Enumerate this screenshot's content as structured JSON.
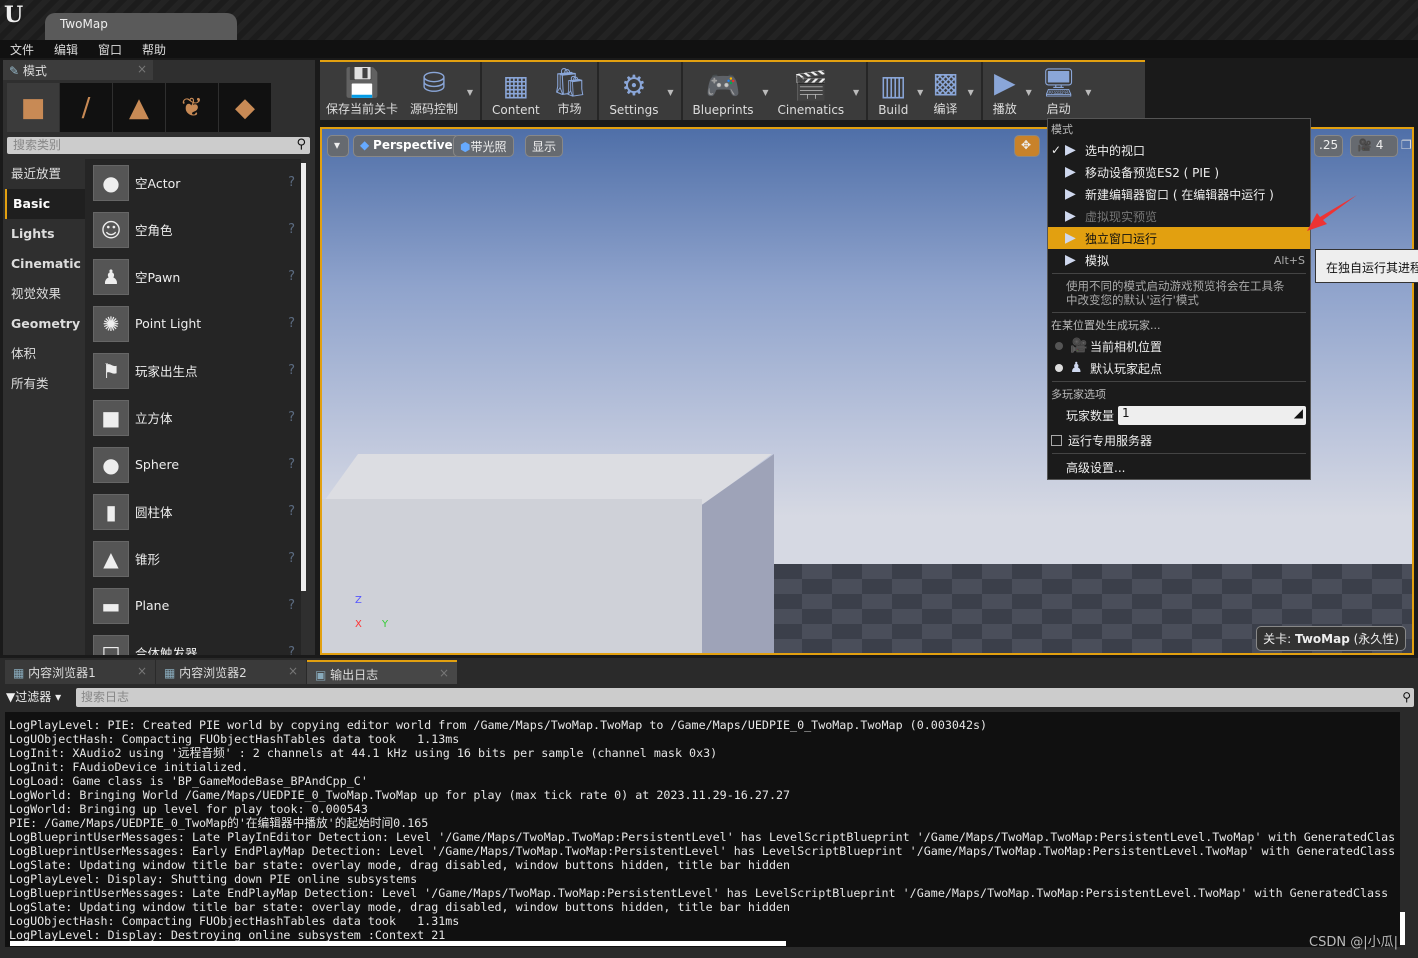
{
  "window": {
    "doc_tab": "TwoMap"
  },
  "menubar": [
    "文件",
    "编辑",
    "窗口",
    "帮助"
  ],
  "modes_panel": {
    "tab": "模式",
    "search_placeholder": "搜索类别",
    "categories": [
      "最近放置",
      "Basic",
      "Lights",
      "Cinematic",
      "视觉效果",
      "Geometry",
      "体积",
      "所有类"
    ],
    "selected_category": "Basic",
    "items": [
      "空Actor",
      "空角色",
      "空Pawn",
      "Point Light",
      "玩家出生点",
      "立方体",
      "Sphere",
      "圆柱体",
      "锥形",
      "Plane",
      "合体触发器"
    ]
  },
  "toolbar": [
    {
      "label": "保存当前关卡",
      "icon": "save-icon",
      "dropdown": false
    },
    {
      "label": "源码控制",
      "icon": "source-control-icon",
      "dropdown": true
    },
    {
      "label": "Content",
      "icon": "content-icon",
      "dropdown": false
    },
    {
      "label": "市场",
      "icon": "marketplace-icon",
      "dropdown": false
    },
    {
      "label": "Settings",
      "icon": "settings-icon",
      "dropdown": true
    },
    {
      "label": "Blueprints",
      "icon": "blueprints-icon",
      "dropdown": true
    },
    {
      "label": "Cinematics",
      "icon": "cinematics-icon",
      "dropdown": true
    },
    {
      "label": "Build",
      "icon": "build-icon",
      "dropdown": true
    },
    {
      "label": "编译",
      "icon": "compile-icon",
      "dropdown": true
    },
    {
      "label": "播放",
      "icon": "play-icon",
      "dropdown": true
    },
    {
      "label": "启动",
      "icon": "launch-icon",
      "dropdown": true
    }
  ],
  "viewport": {
    "perspective": "Perspective",
    "lighting": "带光照",
    "show": "显示",
    "snap_value": ".25",
    "camera_speed": "4",
    "level_label_prefix": "关卡:",
    "level_name": "TwoMap",
    "level_suffix": "(永久性)",
    "axis_z": "Z",
    "axis_x": "X",
    "axis_y": "Y"
  },
  "play_menu": {
    "mode_header": "模式",
    "modes": [
      {
        "label": "选中的视口",
        "checked": true,
        "disabled": false,
        "highlighted": false,
        "shortcut": ""
      },
      {
        "label": "移动设备预览ES2 ( PIE )",
        "checked": false,
        "disabled": false,
        "highlighted": false,
        "shortcut": ""
      },
      {
        "label": "新建编辑器窗口 ( 在编辑器中运行 )",
        "checked": false,
        "disabled": false,
        "highlighted": false,
        "shortcut": ""
      },
      {
        "label": "虚拟现实预览",
        "checked": false,
        "disabled": true,
        "highlighted": false,
        "shortcut": ""
      },
      {
        "label": "独立窗口运行",
        "checked": false,
        "disabled": false,
        "highlighted": true,
        "shortcut": ""
      },
      {
        "label": "模拟",
        "checked": false,
        "disabled": false,
        "highlighted": false,
        "shortcut": "Alt+S"
      }
    ],
    "description": "使用不同的模式启动游戏预览将会在工具条中改变您的默认'运行'模式",
    "spawn_header": "在某位置处生成玩家...",
    "spawn_options": [
      {
        "label": "当前相机位置",
        "selected": false
      },
      {
        "label": "默认玩家起点",
        "selected": true
      }
    ],
    "multiplayer_header": "多玩家选项",
    "players_label": "玩家数量",
    "players_value": "1",
    "dedicated_server": "运行专用服务器",
    "dedicated_server_checked": false,
    "advanced": "高级设置..."
  },
  "tooltip": "在独自运行其进程",
  "bottom_tabs": [
    {
      "label": "内容浏览器1",
      "active": false
    },
    {
      "label": "内容浏览器2",
      "active": false
    },
    {
      "label": "输出日志",
      "active": true
    }
  ],
  "log": {
    "filter": "过滤器",
    "search_placeholder": "搜索日志",
    "lines": [
      "LogPlayLevel: PIE: Created PIE world by copying editor world from /Game/Maps/TwoMap.TwoMap to /Game/Maps/UEDPIE_0_TwoMap.TwoMap (0.003042s)",
      "LogUObjectHash: Compacting FUObjectHashTables data took   1.13ms",
      "LogInit: XAudio2 using '远程音频' : 2 channels at 44.1 kHz using 16 bits per sample (channel mask 0x3)",
      "LogInit: FAudioDevice initialized.",
      "LogLoad: Game class is 'BP_GameModeBase_BPAndCpp_C'",
      "LogWorld: Bringing World /Game/Maps/UEDPIE_0_TwoMap.TwoMap up for play (max tick rate 0) at 2023.11.29-16.27.27",
      "LogWorld: Bringing up level for play took: 0.000543",
      "PIE: /Game/Maps/UEDPIE_0_TwoMap的'在编辑器中播放'的起始时间0.165",
      "LogBlueprintUserMessages: Late PlayInEditor Detection: Level '/Game/Maps/TwoMap.TwoMap:PersistentLevel' has LevelScriptBlueprint '/Game/Maps/TwoMap.TwoMap:PersistentLevel.TwoMap' with GeneratedClass",
      "LogBlueprintUserMessages: Early EndPlayMap Detection: Level '/Game/Maps/TwoMap.TwoMap:PersistentLevel' has LevelScriptBlueprint '/Game/Maps/TwoMap.TwoMap:PersistentLevel.TwoMap' with GeneratedClass",
      "LogSlate: Updating window title bar state: overlay mode, drag disabled, window buttons hidden, title bar hidden",
      "LogPlayLevel: Display: Shutting down PIE online subsystems",
      "LogBlueprintUserMessages: Late EndPlayMap Detection: Level '/Game/Maps/TwoMap.TwoMap:PersistentLevel' has LevelScriptBlueprint '/Game/Maps/TwoMap.TwoMap:PersistentLevel.TwoMap' with GeneratedClass '",
      "LogSlate: Updating window title bar state: overlay mode, drag disabled, window buttons hidden, title bar hidden",
      "LogUObjectHash: Compacting FUObjectHashTables data took   1.31ms",
      "LogPlayLevel: Display: Destroying online subsystem :Context_21"
    ]
  },
  "watermark": "CSDN @|小瓜|",
  "colors": {
    "accent": "#e2a010",
    "annotation_arrow": "#ee3333"
  }
}
